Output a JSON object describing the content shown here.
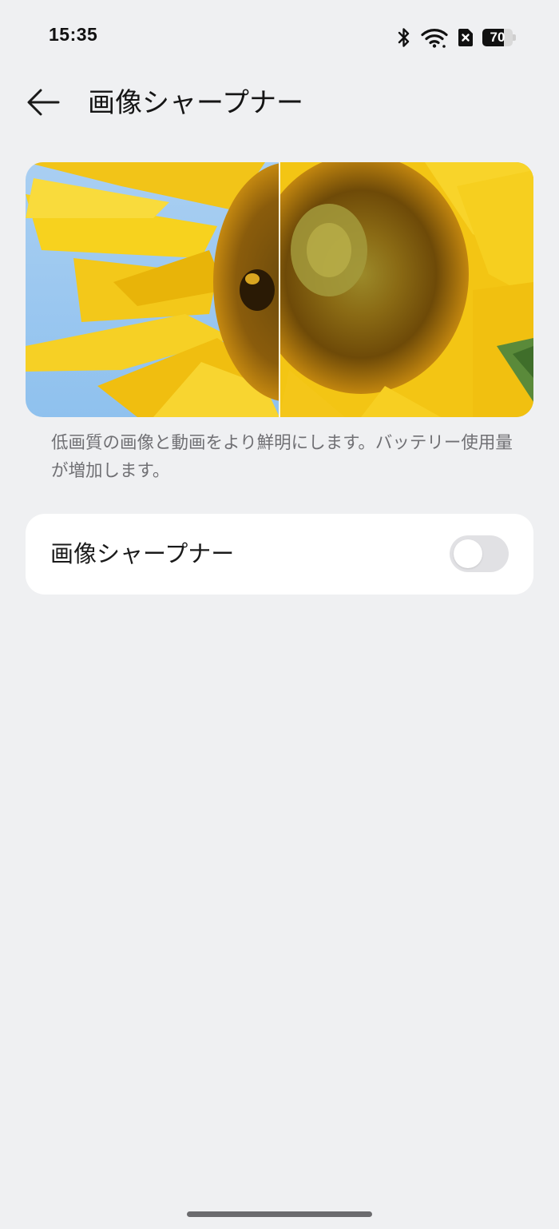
{
  "status_bar": {
    "time": "15:35",
    "battery_level": "70",
    "battery_fraction": 0.7,
    "icons": [
      "bluetooth-icon",
      "wifi-icon",
      "no-sim-icon",
      "battery-icon"
    ]
  },
  "header": {
    "title": "画像シャープナー",
    "back_icon": "arrow-left-icon"
  },
  "preview": {
    "image": "sunflower-comparison-image",
    "divider": "before-after-split"
  },
  "description": "低画質の画像と動画をより鮮明にします。バッテリー使用量が増加します。",
  "setting": {
    "label": "画像シャープナー",
    "enabled": false
  },
  "colors": {
    "background": "#eff0f2",
    "card": "#ffffff",
    "toggle_off": "#e1e1e4",
    "description_text": "#707074"
  }
}
